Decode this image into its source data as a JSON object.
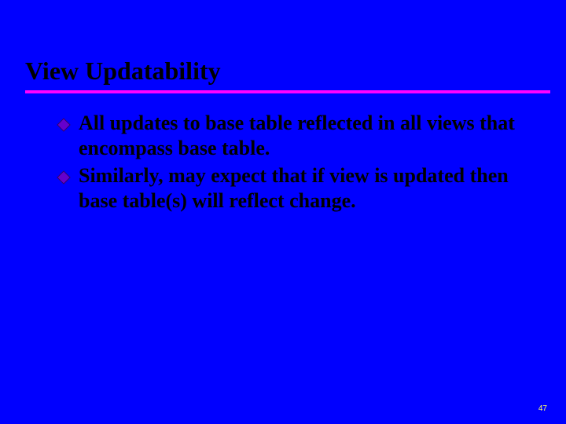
{
  "slide": {
    "title": "View Updatability",
    "bullets": [
      "All updates to base table reflected in all views that encompass base table.",
      "Similarly, may expect that if view is updated then base table(s) will reflect change."
    ],
    "page_number": "47"
  },
  "colors": {
    "background": "#0000ff",
    "accent_rule": "#ff00ff",
    "bullet_fill": "#6600cc",
    "page_number": "#ffff66"
  }
}
